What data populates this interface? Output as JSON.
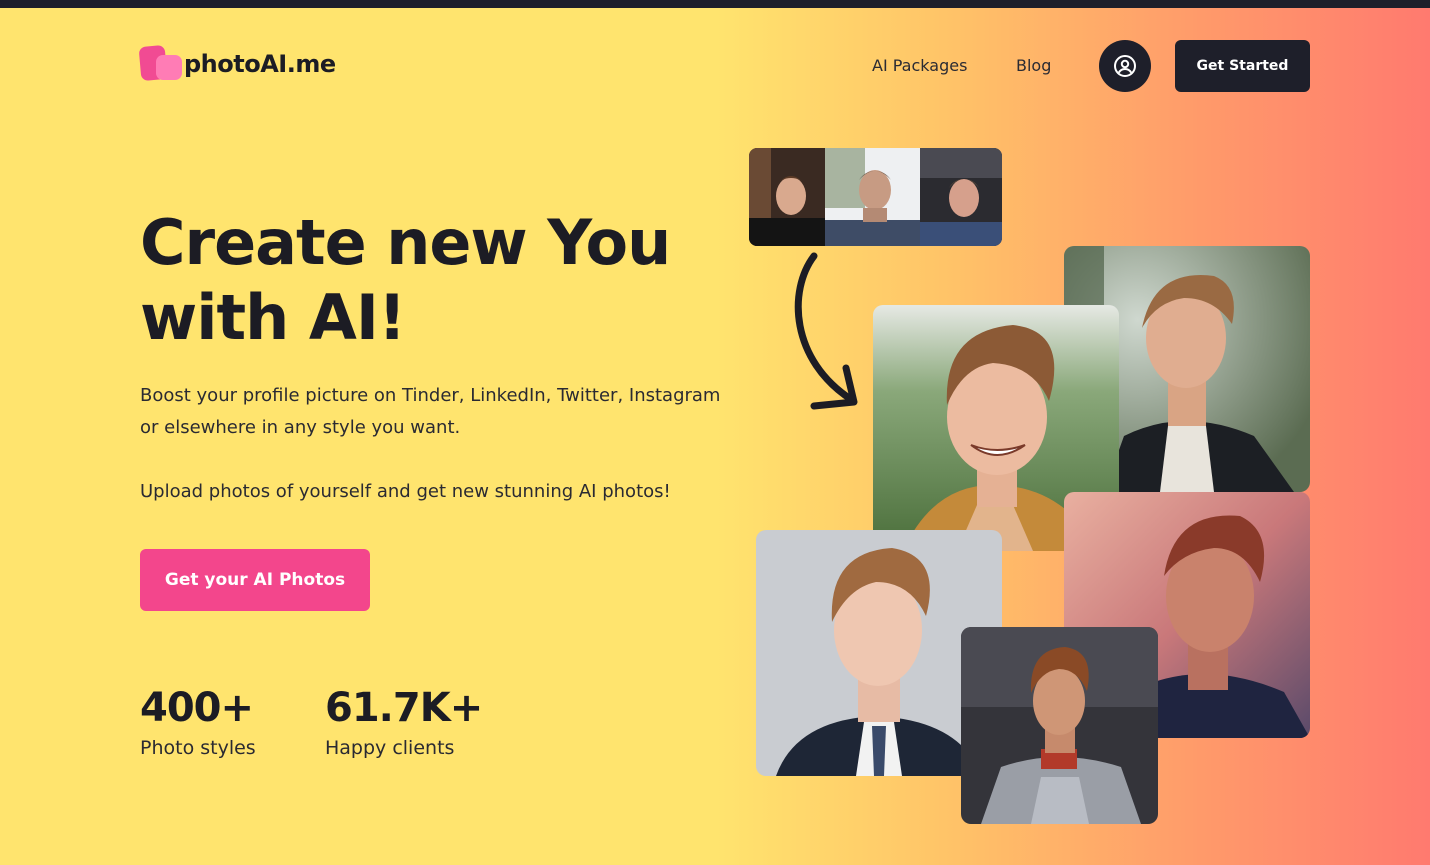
{
  "header": {
    "logo_text": "photoAI.me",
    "nav": [
      "AI Packages",
      "Blog"
    ],
    "account_icon": "user-circle-icon",
    "cta_label": "Get Started"
  },
  "hero": {
    "title_line1": "Create new You",
    "title_line2": "with AI!",
    "description_1": "Boost your profile picture on Tinder, LinkedIn, Twitter, Instagram or elsewhere in any style you want.",
    "description_2": "Upload photos of yourself and get new stunning AI photos!",
    "cta_label": "Get your AI Photos"
  },
  "stats": [
    {
      "value": "400+",
      "label": "Photo styles"
    },
    {
      "value": "61.7K+",
      "label": "Happy clients"
    }
  ],
  "colors": {
    "dark": "#1e1f2a",
    "pink_cta": "#f3468c",
    "logo_pink": "#f14b93",
    "bg_yellow": "#ffe46e",
    "bg_coral": "#ff7a6f"
  },
  "icons": {
    "arrow": "curved-arrow-down-right-icon"
  }
}
